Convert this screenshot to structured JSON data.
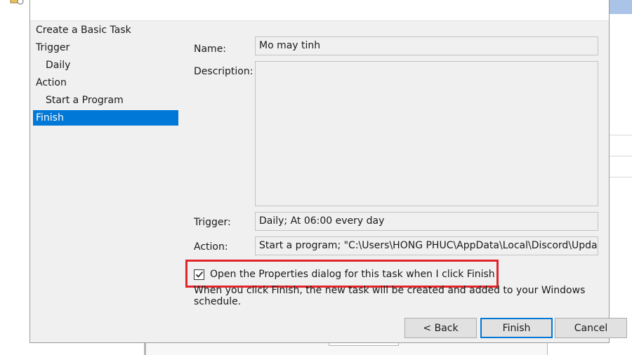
{
  "wizard": {
    "nav": [
      {
        "label": "Create a Basic Task",
        "sub": false,
        "selected": false
      },
      {
        "label": "Trigger",
        "sub": false,
        "selected": false
      },
      {
        "label": "Daily",
        "sub": true,
        "selected": false
      },
      {
        "label": "Action",
        "sub": false,
        "selected": false
      },
      {
        "label": "Start a Program",
        "sub": true,
        "selected": false
      },
      {
        "label": "Finish",
        "sub": false,
        "selected": true
      }
    ],
    "form": {
      "name_label": "Name:",
      "name_value": "Mo may tinh",
      "description_label": "Description:",
      "description_value": "",
      "trigger_label": "Trigger:",
      "trigger_value": "Daily; At 06:00 every day",
      "action_label": "Action:",
      "action_value": "Start a program; \"C:\\Users\\HONG PHUC\\AppData\\Local\\Discord\\Update.exe\""
    },
    "open_properties": {
      "checked": true,
      "label": "Open the Properties dialog for this task when I click Finish"
    },
    "info_text": "When you click Finish, the new task will be created and added to your Windows schedule.",
    "buttons": {
      "back": "< Back",
      "finish": "Finish",
      "cancel": "Cancel"
    }
  },
  "colors": {
    "selection": "#0078d7",
    "highlight_box": "#e0262a"
  }
}
